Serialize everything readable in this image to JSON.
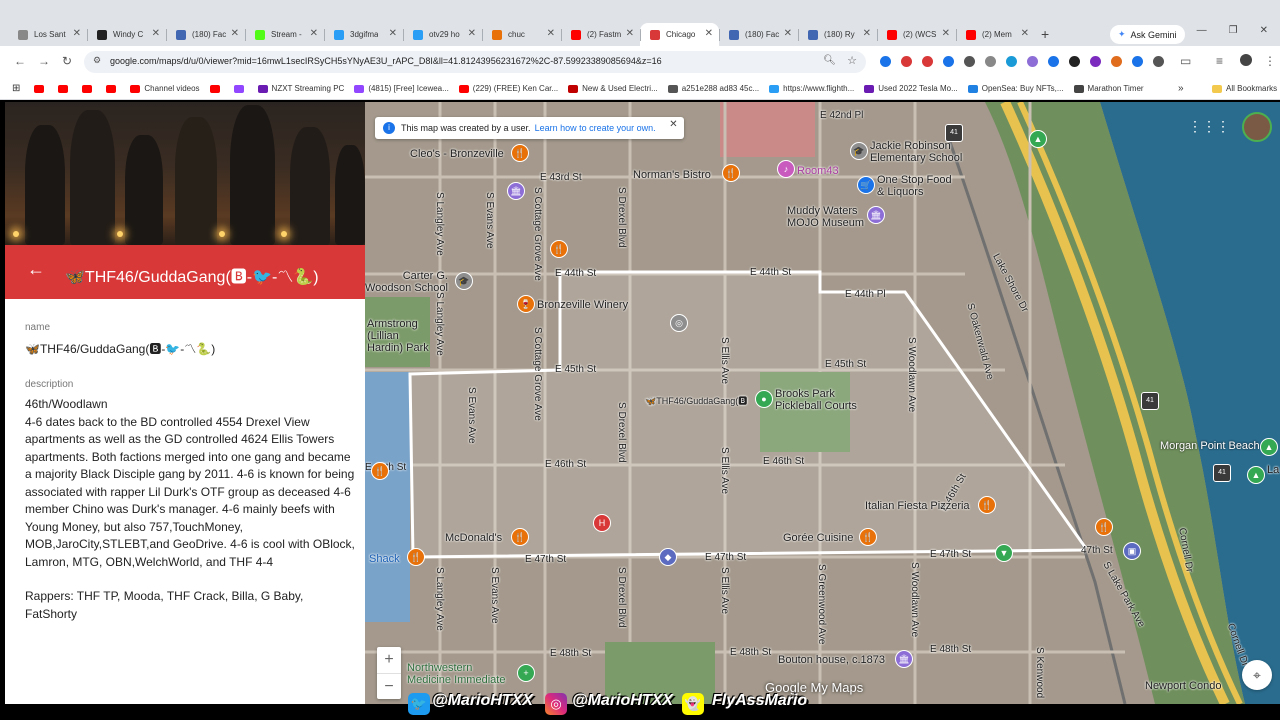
{
  "browser": {
    "tabs": [
      {
        "label": "Los Sant",
        "color": "#888888"
      },
      {
        "label": "Windy C",
        "color": "#222222"
      },
      {
        "label": "(180) Fac",
        "color": "#4267b2"
      },
      {
        "label": "Stream -",
        "color": "#53fc18"
      },
      {
        "label": "3dgifma",
        "color": "#2a9df4"
      },
      {
        "label": "otv29 ho",
        "color": "#2a9df4"
      },
      {
        "label": "chuc",
        "color": "#e8710a"
      },
      {
        "label": "(2) Fastm",
        "color": "#ff0000"
      },
      {
        "label": "Chicago",
        "color": "#d93838",
        "active": true
      },
      {
        "label": "(180) Fac",
        "color": "#4267b2"
      },
      {
        "label": "(180) Ry",
        "color": "#4267b2"
      },
      {
        "label": "(2) (WCS",
        "color": "#ff0000"
      },
      {
        "label": "(2) Mem",
        "color": "#ff0000"
      }
    ],
    "new_tab": "+",
    "gemini_label": "Ask Gemini",
    "url": "google.com/maps/d/u/0/viewer?mid=16mwL1secIRSyCH5sYNyAE3U_rAPC_D8I&ll=41.812439562316​72%2C-87.59923389085694&z=16",
    "bookmarks": [
      {
        "label": "",
        "color": "#ff0000"
      },
      {
        "label": "",
        "color": "#ff0000"
      },
      {
        "label": "",
        "color": "#ff0000"
      },
      {
        "label": "",
        "color": "#ff0000"
      },
      {
        "label": "Channel videos",
        "color": "#ff0000"
      },
      {
        "label": "",
        "color": "#ff0000"
      },
      {
        "label": "",
        "color": "#9146ff"
      },
      {
        "label": "NZXT Streaming PC",
        "color": "#6a1bb1"
      },
      {
        "label": "(4815) [Free] Icewea...",
        "color": "#9146ff"
      },
      {
        "label": "(229) (FREE) Ken Car...",
        "color": "#ff0000"
      },
      {
        "label": "New & Used Electri...",
        "color": "#c00000"
      },
      {
        "label": "a251e288 ad83 45c...",
        "color": "#555555"
      },
      {
        "label": "https://www.flighth...",
        "color": "#2a9df4"
      },
      {
        "label": "Used 2022 Tesla Mo...",
        "color": "#6a1bb1"
      },
      {
        "label": "OpenSea: Buy NFTs,...",
        "color": "#2081e2"
      },
      {
        "label": "Marathon Timer",
        "color": "#444444"
      }
    ],
    "all_bookmarks": "All Bookmarks"
  },
  "panel": {
    "title": "🦋THF46/GuddaGang(🅱-🐦-〽🐍)",
    "name_label": "name",
    "name_value": "🦋THF46/GuddaGang(🅱-🐦-〽🐍)",
    "description_label": "description",
    "description_lines": [
      "46th/Woodlawn",
      "4-6 dates back to the BD controlled 4554 Drexel View apartments as well as the GD controlled 4624 Ellis Towers apartments. Both factions merged into one gang and became a majority Black Disciple gang by 2011. 4-6 is known for being associated with rapper Lil Durk's OTF group as deceased 4-6 member Chino was Durk's manager. 4-6 mainly beefs with Young Money, but also 757,TouchMoney, MOB,JaroCity,STLEBT,and GeoDrive. 4-6 is cool with OBlock, Lamron, MTG, OBN,WelchWorld, and THF 4-4",
      "",
      "Rappers: THF TP, Mooda, THF Crack, Billa, G Baby, FatShorty"
    ]
  },
  "map": {
    "notice_text": "This map was created by a user.",
    "notice_link": "Learn how to create your own.",
    "streets": {
      "e42nd": "E 42nd Pl",
      "e43rd": "E 43rd St",
      "e44th_a": "E 44th St",
      "e44th_b": "E 44th St",
      "e44th_pl": "E 44th Pl",
      "e45th_a": "E 45th St",
      "e45th_b": "E 45th St",
      "e46th_a": "E 46th St",
      "e46th_b": "E 46th St",
      "e46th_c": "E 46th St",
      "e46th_left": "E 46th St",
      "e47th_a": "E 47th St",
      "e47th_b": "E 47th St",
      "e47th_c": "E 47th St",
      "e47th_d": "47th St",
      "e48th_a": "E 48th St",
      "e48th_b": "E 48th St",
      "e48th_c": "E 48th St",
      "langley1": "S Langley Ave",
      "langley2": "S Langley Ave",
      "langley3": "S Langley Ave",
      "evans1": "S Evans Ave",
      "evans2": "S Evans Ave",
      "evans3": "S Evans Ave",
      "cottage1": "S Cottage Grove Ave",
      "cottage2": "S Cottage Grove Ave",
      "drexel1": "S Drexel Blvd",
      "drexel2": "S Drexel Blvd",
      "drexel3": "S Drexel Blvd",
      "ellis1": "S Ellis Ave",
      "ellis2": "S Ellis Ave",
      "ellis3": "S Ellis Ave",
      "greenwood": "S Greenwood Ave",
      "woodlawn1": "S Woodlawn Ave",
      "woodlawn2": "S Woodlawn Ave",
      "oakenwald": "S Oakenwald Ave",
      "lakeshore": "Lake Shore Dr",
      "lakepark": "S Lake Park Ave",
      "cornell": "Cornell Dr",
      "cornelldr2": "Cornell Dr",
      "kenwood": "S Kenwood"
    },
    "pois": {
      "cleos": "Cleo's - Bronzeville",
      "normans": "Norman's Bistro",
      "room43": "Room43",
      "jackie": "Jackie Robinson\nElementary School",
      "onestop": "One Stop Food\n& Liquors",
      "muddy": "Muddy Waters\nMOJO Museum",
      "carter": "Carter G.\nWoodson School",
      "winery": "Bronzeville Winery",
      "armstrong": "Armstrong\n(Lillian\nHardin) Park",
      "brooks": "Brooks Park\nPickleball Courts",
      "marker": "🦋THF46/GuddaGang(🅱",
      "italian": "Italian Fiesta Pizzeria",
      "goree": "Gorée Cuisine",
      "mcd": "McDonald's",
      "morgan": "Morgan Point Beach",
      "shack": "Shack",
      "northwestern": "Northwestern\nMedicine Immediate",
      "bouton": "Bouton house, c.1873",
      "newport": "Newport Condo",
      "la": "La"
    },
    "highway_shield": "41",
    "highway_shield_2": "41",
    "highway_shield_3": "41",
    "zoom_in": "+",
    "zoom_out": "−",
    "brand": "Google My Maps"
  },
  "overlay": {
    "twitter": "@MarioHTXX",
    "instagram": "@MarioHTXX",
    "snapchat": "FlyAssMario"
  }
}
